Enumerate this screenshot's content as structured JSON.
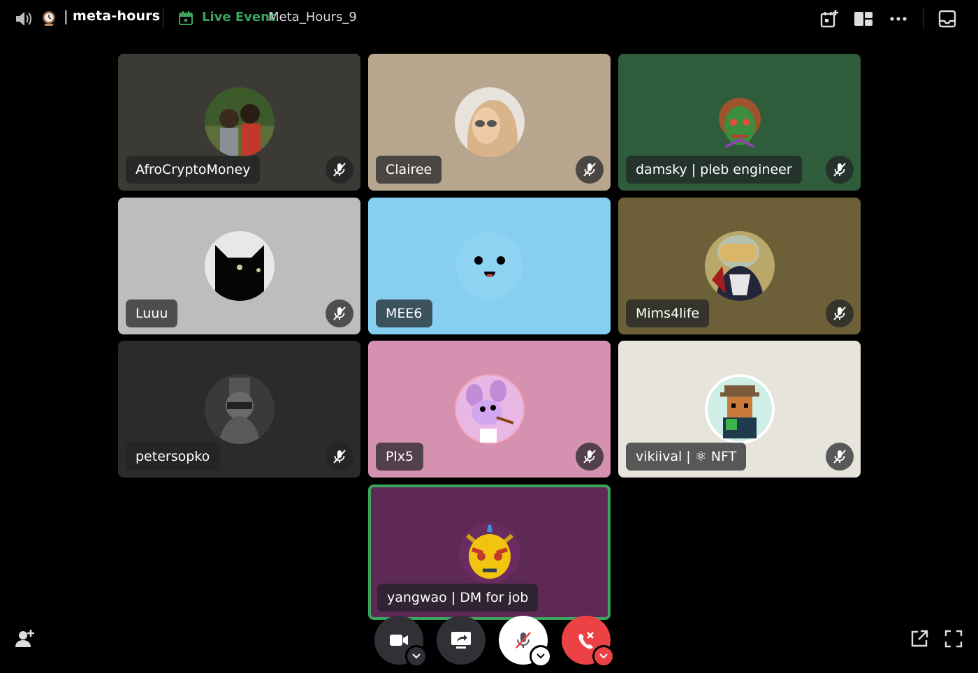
{
  "header": {
    "channel_name": "meta-hours",
    "pipe": "|",
    "live_label": "Live Event",
    "event_name": "Meta_Hours_9",
    "accent_live": "#3ba55c",
    "icons": [
      "voice-channel-icon",
      "clock-emoji-icon",
      "calendar-icon",
      "add-activity-icon",
      "grid-layout-icon",
      "more-options-icon",
      "inbox-icon"
    ]
  },
  "participants": [
    {
      "name": "AfroCryptoMoney",
      "bg": "#3b3a35",
      "muted": true
    },
    {
      "name": "Clairee",
      "bg": "#b7a58e",
      "muted": true
    },
    {
      "name": "damsky | pleb engineer",
      "bg": "#2f5d3b",
      "muted": true
    },
    {
      "name": "Luuu",
      "bg": "#bdbdbd",
      "muted": true
    },
    {
      "name": "MEE6",
      "bg": "#86cff1",
      "muted": false
    },
    {
      "name": "Mims4life",
      "bg": "#6d6038",
      "muted": true
    },
    {
      "name": "petersopko",
      "bg": "#2b2b2b",
      "muted": true
    },
    {
      "name": "Plx5",
      "bg": "#d491b0",
      "muted": true
    },
    {
      "name": "vikiival | ⚛ NFT",
      "bg": "#e7e4dc",
      "muted": true
    },
    {
      "name": "yangwao | DM for job",
      "bg": "#5e2a55",
      "muted": false,
      "speaking": true
    }
  ],
  "controls": {
    "camera": "camera-button",
    "screen_share": "screen-share-button",
    "mute": "mute-button",
    "leave": "leave-call-button",
    "leave_color": "#ed4245",
    "dark_btn": "#2f3136"
  },
  "footer_icons": [
    "add-user-icon",
    "popout-icon",
    "fullscreen-icon"
  ]
}
